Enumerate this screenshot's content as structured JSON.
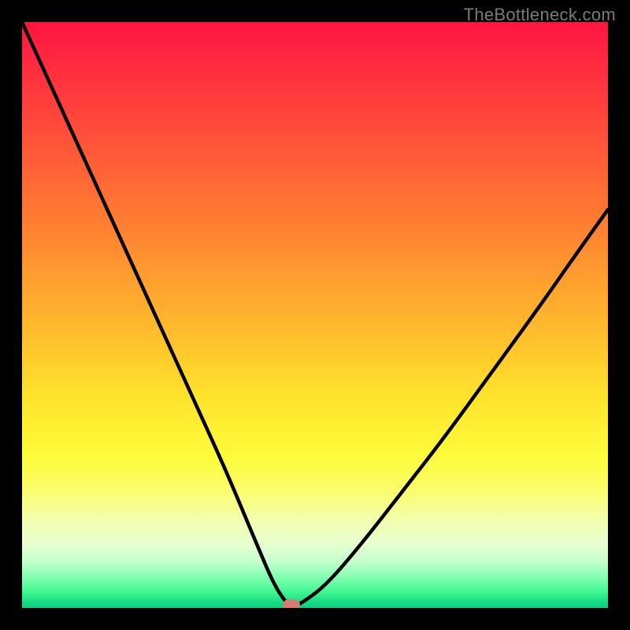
{
  "watermark": "TheBottleneck.com",
  "colors": {
    "background": "#000000",
    "curve": "#000000",
    "marker": "#d77a6f"
  },
  "chart_data": {
    "type": "line",
    "title": "",
    "xlabel": "",
    "ylabel": "",
    "xlim": [
      0,
      100
    ],
    "ylim": [
      0,
      100
    ],
    "annotations": [
      {
        "name": "min-marker",
        "x": 46,
        "y": 0
      }
    ],
    "series": [
      {
        "name": "bottleneck-curve",
        "x": [
          0,
          5,
          10,
          15,
          20,
          25,
          30,
          35,
          40,
          43,
          45,
          46,
          48,
          52,
          58,
          65,
          72,
          80,
          88,
          95,
          100
        ],
        "y": [
          100,
          89,
          78,
          67,
          56,
          45,
          34,
          23,
          11,
          4,
          1,
          0,
          1,
          4,
          11,
          20,
          29,
          40,
          51,
          61,
          68
        ]
      }
    ],
    "background_gradient_stops": [
      {
        "pct": 0,
        "hex": "#ff143f"
      },
      {
        "pct": 6,
        "hex": "#ff2740"
      },
      {
        "pct": 18,
        "hex": "#ff4b3a"
      },
      {
        "pct": 34,
        "hex": "#ff7d32"
      },
      {
        "pct": 50,
        "hex": "#ffb22d"
      },
      {
        "pct": 64,
        "hex": "#ffe32c"
      },
      {
        "pct": 74,
        "hex": "#fdfb3a"
      },
      {
        "pct": 80,
        "hex": "#fbfd6b"
      },
      {
        "pct": 85,
        "hex": "#f3ffae"
      },
      {
        "pct": 89,
        "hex": "#e8ffd0"
      },
      {
        "pct": 92,
        "hex": "#c6ffcf"
      },
      {
        "pct": 95,
        "hex": "#7dffae"
      },
      {
        "pct": 97.5,
        "hex": "#39f58f"
      },
      {
        "pct": 99,
        "hex": "#17db82"
      },
      {
        "pct": 100,
        "hex": "#10ce7d"
      }
    ]
  }
}
